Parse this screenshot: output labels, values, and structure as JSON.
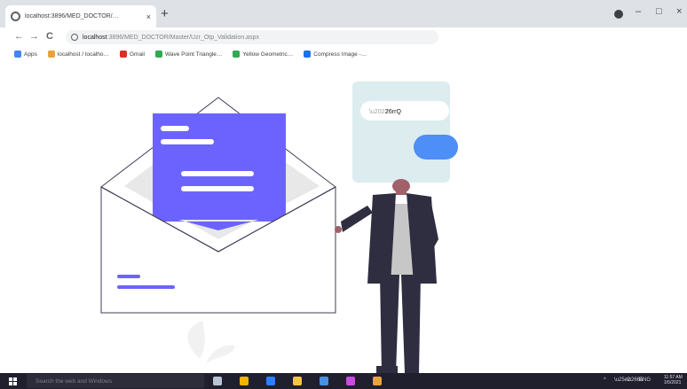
{
  "browser": {
    "tab": {
      "title": "localhost:3896/MED_DOCTOR/…",
      "close": "×"
    },
    "new_tab": "+",
    "window": {
      "minimize": "–",
      "maximize": "□",
      "close": "×"
    },
    "nav": {
      "back": "←",
      "forward": "→",
      "reload": "C"
    },
    "url": {
      "host": "localhost",
      "path": ":3896/MED_DOCTOR/Master/Uzr_Otp_Validation.aspx"
    },
    "bookmarks": [
      {
        "label": "Apps",
        "color": "#4285f4"
      },
      {
        "label": "localhost / localho…",
        "color": "#e8a33a"
      },
      {
        "label": "Gmail",
        "color": "#d93025"
      },
      {
        "label": "Wave Point Triangle…",
        "color": "#34a853"
      },
      {
        "label": "Yellow Geometric…",
        "color": "#34a853"
      },
      {
        "label": "Compress Image -…",
        "color": "#1a73e8"
      }
    ]
  },
  "otp_card": {
    "input_value": "26rrQ",
    "button_color": "#4d8ef7"
  },
  "illustration": {
    "accent_color": "#6c63ff",
    "paper_color": "#ffffff",
    "card_bg": "#dcecef"
  },
  "taskbar": {
    "search_placeholder": "Search the web and Windows",
    "clock_time": "11:57 AM",
    "clock_date": "1/5/2021",
    "apps": [
      {
        "name": "task-view",
        "color": "#b8c4d6"
      },
      {
        "name": "chrome",
        "color": "#f2b400"
      },
      {
        "name": "store",
        "color": "#2d7ff9"
      },
      {
        "name": "explorer",
        "color": "#f4c542"
      },
      {
        "name": "edge",
        "color": "#4a90e2"
      },
      {
        "name": "photos",
        "color": "#c94ce0"
      },
      {
        "name": "slack",
        "color": "#e8a33a"
      }
    ]
  }
}
